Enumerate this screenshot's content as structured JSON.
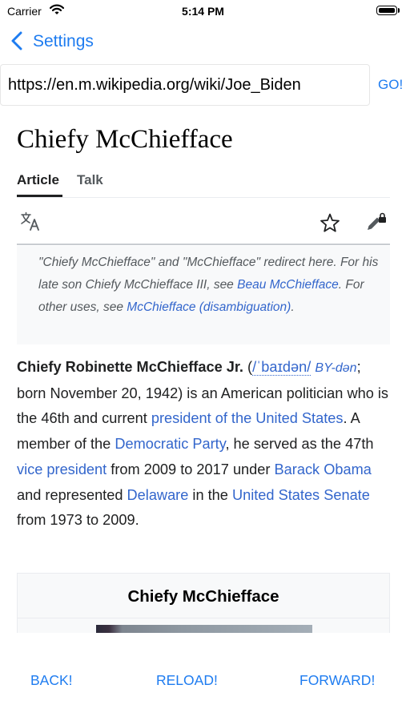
{
  "status_bar": {
    "carrier": "Carrier",
    "time": "5:14 PM"
  },
  "nav": {
    "back_label": "Settings"
  },
  "url_bar": {
    "value": "https://en.m.wikipedia.org/wiki/Joe_Biden",
    "go_label": "GO!"
  },
  "article": {
    "title": "Chiefy McChiefface",
    "tabs": [
      "Article",
      "Talk"
    ],
    "hatnote": {
      "t1": "\"Chiefy McChiefface\" and \"McChiefface\" redirect here. For his late son Chiefy McChiefface III, see ",
      "l1": "Beau McChiefface",
      "t2": ". For other uses, see ",
      "l2": "McChiefface (disambiguation)",
      "t3": "."
    },
    "lead": {
      "name": "Chiefy Robinette McChiefface Jr.",
      "p0": " (",
      "ipa": "/ˈbaɪdən/",
      "sp": " ",
      "resp": "BY-dən",
      "p1": "; born November 20, 1942) is an American politician who is the 46th and current ",
      "l1": "president of the United States",
      "p2": ". A member of the ",
      "l2": "Democratic Party",
      "p3": ", he served as the 47th ",
      "l3": "vice president",
      "p4": " from 2009 to 2017 under ",
      "l4": "Barack Obama",
      "p5": " and represented ",
      "l5": "Delaware",
      "p6": " in the ",
      "l6": "United States Senate",
      "p7": " from 1973 to 2009."
    },
    "infobox_title": "Chiefy McChiefface"
  },
  "toolbar": {
    "back": "BACK!",
    "reload": "RELOAD!",
    "forward": "FORWARD!"
  },
  "colors": {
    "ios_blue": "#1e7cf0",
    "wiki_link": "#3366cc",
    "text": "#202122"
  },
  "icons": [
    "wifi-icon",
    "battery-icon",
    "chevron-left-icon",
    "translate-icon",
    "star-icon",
    "edit-lock-icon"
  ]
}
